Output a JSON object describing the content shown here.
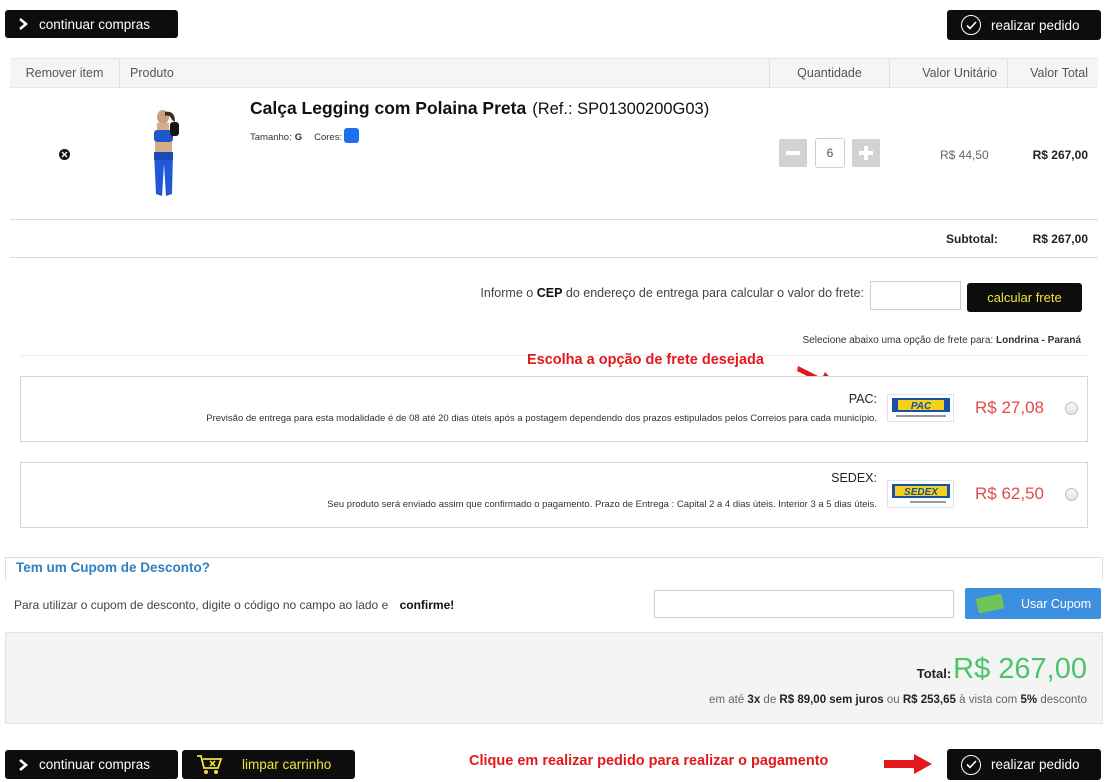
{
  "top": {
    "continue_label": "continuar compras",
    "order_label": "realizar pedido"
  },
  "table": {
    "headers": {
      "remove": "Remover item",
      "product": "Produto",
      "quantity": "Quantidade",
      "unit_value": "Valor Unitário",
      "total_value": "Valor Total"
    }
  },
  "item": {
    "name": "Calça Legging com Polaina Preta",
    "ref": "(Ref.: SP01300200G03)",
    "size_label": "Tamanho:",
    "size_value": "G",
    "colors_label": "Cores:",
    "color_hex": "#1e6ef0",
    "quantity": "6",
    "unit_price": "R$ 44,50",
    "total_price": "R$ 267,00"
  },
  "subtotal": {
    "label": "Subtotal:",
    "value": "R$ 267,00"
  },
  "shipping": {
    "cep_prefix": "Informe o",
    "cep_bold": "CEP",
    "cep_suffix": "do endereço de entrega para calcular o valor do frete:",
    "calc_label": "calcular frete",
    "select_prefix": "Selecione abaixo uma opção de frete para:",
    "select_city": "Londrina - Paraná",
    "options": [
      {
        "name": "PAC",
        "desc": "Previsão de entrega para esta modalidade é de 08 até 20 dias úteis após a postagem dependendo dos prazos estipulados pelos Correios para cada município.",
        "logo": "PAC",
        "price": "R$ 27,08"
      },
      {
        "name": "SEDEX",
        "desc": "Seu produto será enviado assim que confirmado o pagamento. Prazo de Entrega : Capital 2 a 4 dias úteis. Interior 3 a 5 dias úteis.",
        "logo": "SEDEX",
        "price": "R$ 62,50"
      }
    ]
  },
  "annotations": {
    "shipping_hint": "Escolha a opção de frete desejada",
    "order_hint": "Clique em realizar pedido para realizar o pagamento",
    "color": "#e2181c"
  },
  "coupon": {
    "title": "Tem um Cupom de Desconto?",
    "text": "Para utilizar o cupom de desconto, digite o código no campo ao lado e",
    "text_bold": "confirme!",
    "button_label": "Usar Cupom"
  },
  "totals": {
    "label": "Total:",
    "value": "R$ 267,00",
    "installments_prefix": "em até",
    "installments_count": "3x",
    "installments_mid": "de",
    "installment_value": "R$ 89,00 sem juros",
    "installments_or": "ou",
    "cash_value": "R$ 253,65",
    "cash_mid": "à vista com",
    "discount": "5%",
    "discount_suffix": "desconto"
  },
  "bottom": {
    "continue_label": "continuar compras",
    "clear_label": "limpar carrinho",
    "order_label": "realizar pedido"
  },
  "colors": {
    "accent_yellow": "#f2e13d",
    "price_red": "#e34a4a",
    "total_green": "#4cc46c",
    "coupon_blue": "#3d8fe0"
  }
}
